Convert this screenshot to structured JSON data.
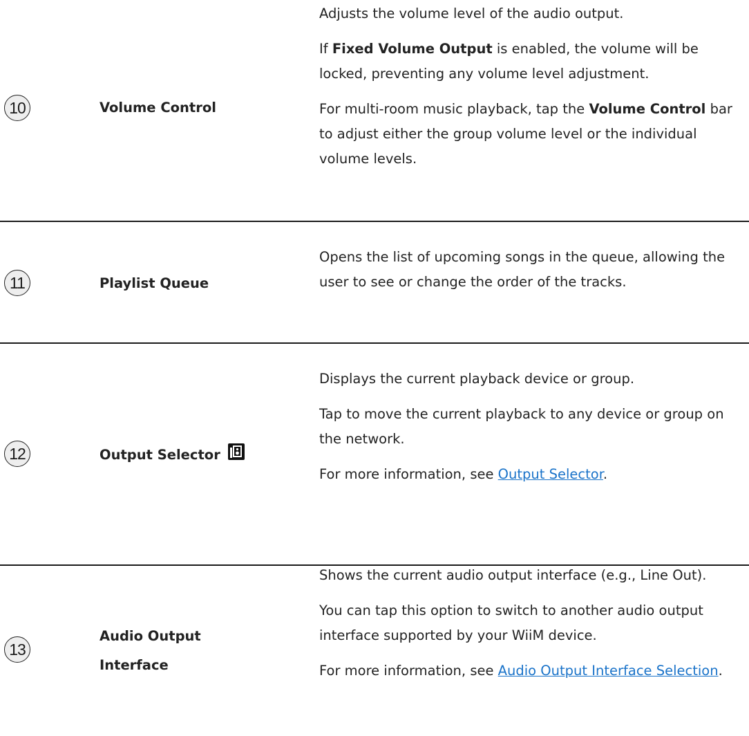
{
  "rows": [
    {
      "number": "10",
      "name": "Volume Control",
      "p1": "Adjusts the volume level of the audio output.",
      "p2_pre": "If ",
      "p2_bold": "Fixed Volume Output",
      "p2_post": " is enabled, the volume will be locked, preventing any volume level adjustment.",
      "p3_pre": "For multi-room music playback, tap the ",
      "p3_bold": "Volume Control",
      "p3_post": " bar to adjust either the group volume level or the individual volume levels."
    },
    {
      "number": "11",
      "name": "Playlist Queue",
      "p1": "Opens the list of upcoming songs in the queue, allowing the user to see or change the order of the tracks."
    },
    {
      "number": "12",
      "name": "Output Selector",
      "icon": "output-selector-icon",
      "p1": "Displays the current playback device or group.",
      "p2": "Tap to move the current playback to any device or group on the network.",
      "p3_pre": "For more information, see ",
      "p3_link": "Output Selector",
      "p3_post": "."
    },
    {
      "number": "13",
      "name_line1": "Audio Output",
      "name_line2": "Interface",
      "p1": "Shows the current audio output interface (e.g., Line Out).",
      "p2": "You can tap this option to switch to another audio output interface supported by your WiiM device.",
      "p3_pre": "For more information, see ",
      "p3_link": "Audio Output Interface Selection",
      "p3_post": "."
    }
  ],
  "colors": {
    "link": "#1a73c9",
    "text": "#222222",
    "divider": "#1a1a1a",
    "badge_bg": "#eeeeee"
  }
}
